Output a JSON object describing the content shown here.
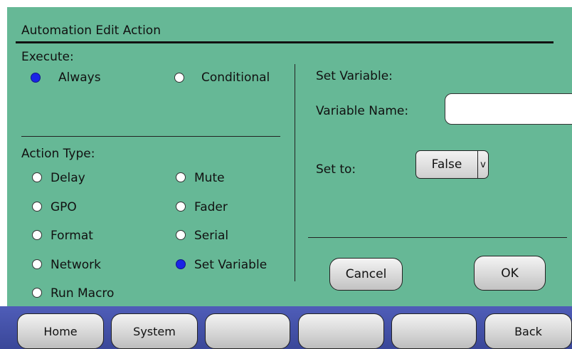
{
  "title": "Automation Edit Action",
  "execute": {
    "label": "Execute:",
    "options": [
      {
        "label": "Always",
        "selected": true
      },
      {
        "label": "Conditional",
        "selected": false
      }
    ]
  },
  "action_type": {
    "label": "Action Type:",
    "options": [
      {
        "label": "Delay",
        "selected": false
      },
      {
        "label": "Mute",
        "selected": false
      },
      {
        "label": "GPO",
        "selected": false
      },
      {
        "label": "Fader",
        "selected": false
      },
      {
        "label": "Format",
        "selected": false
      },
      {
        "label": "Serial",
        "selected": false
      },
      {
        "label": "Network",
        "selected": false
      },
      {
        "label": "Set Variable",
        "selected": true
      },
      {
        "label": "Run Macro",
        "selected": false
      }
    ]
  },
  "set_variable": {
    "heading": "Set Variable:",
    "name_label": "Variable Name:",
    "name_value": "",
    "set_to_label": "Set to:",
    "set_to_value": "False",
    "dropdown_arrow": "v"
  },
  "dialog": {
    "cancel_label": "Cancel",
    "ok_label": "OK"
  },
  "nav": {
    "home": "Home",
    "system": "System",
    "blank1": "",
    "blank2": "",
    "blank3": "",
    "back": "Back"
  },
  "colors": {
    "panel": "#66b896",
    "selected_radio": "#1a24e6",
    "navbar": "#3f4ca6"
  }
}
